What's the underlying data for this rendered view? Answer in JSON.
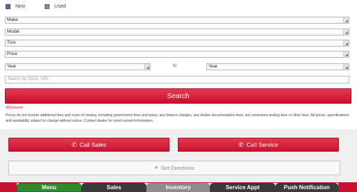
{
  "condition": {
    "new_label": "New",
    "used_label": "Used"
  },
  "filters": {
    "make": "Make",
    "model": "Model",
    "trim": "Trim",
    "price": "Price",
    "year_from": "Year",
    "year_to": "Year",
    "to_label": "to"
  },
  "search": {
    "placeholder": "Search by Stock, VIN...",
    "button_label": "Search"
  },
  "disclosure": {
    "link": "•Disclosure",
    "text": "Prices do not include additional fees and costs of closing, including government fees and taxes, any finance charges, any dealer documentation fees, any emissions testing fees or other fees. All prices, specifications and availability subject to change without notice. Contact dealer for most current information."
  },
  "actions": {
    "call_sales": "Call Sales",
    "call_service": "Call Service",
    "directions": "Get Directions"
  },
  "nav": {
    "menu": "Menu",
    "sales": "Sales",
    "inventory": "Inventory",
    "service_appt": "Service Appt",
    "push": "Push Notification"
  },
  "colors": {
    "brand_red": "#c8102e",
    "menu_green": "#2e8b2e"
  }
}
